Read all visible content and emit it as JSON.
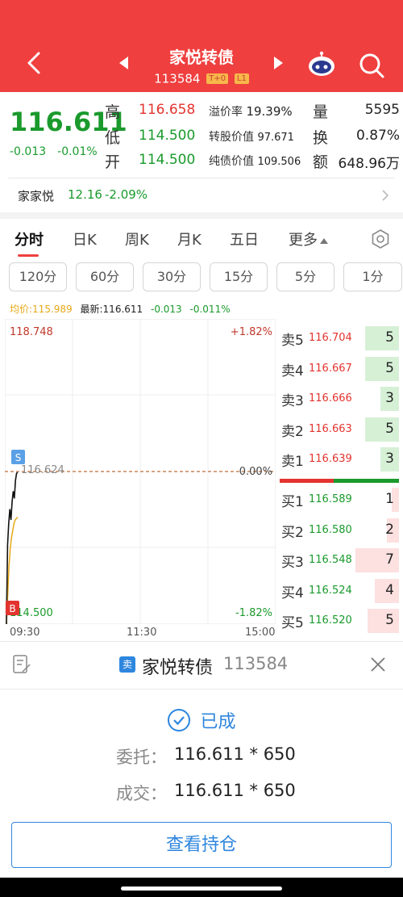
{
  "header": {
    "title": "家悦转债",
    "code": "113584",
    "tag1": "T+0",
    "tag2": "L1",
    "icons": [
      "back-icon",
      "prev-arrow-icon",
      "next-arrow-icon",
      "robot-assistant-icon",
      "search-icon"
    ]
  },
  "quote": {
    "price": "116.611",
    "change": "-0.013",
    "change_pct": "-0.01%",
    "high_label": "高",
    "high": "116.658",
    "low_label": "低",
    "low": "114.500",
    "open_label": "开",
    "open": "114.500",
    "premium_label": "溢价率",
    "premium": "19.39%",
    "conv_value_label": "转股价值",
    "conv_value": "97.671",
    "bond_value_label": "纯债价值",
    "bond_value": "109.506",
    "volume_label": "量",
    "volume": "5595",
    "turnover_label": "换",
    "turnover": "0.87%",
    "amount_label": "额",
    "amount": "648.96万"
  },
  "underlying": {
    "name": "家家悦",
    "price": "12.16",
    "change_pct": "-2.09%"
  },
  "tabs": {
    "items": [
      "分时",
      "日K",
      "周K",
      "月K",
      "五日",
      "更多"
    ],
    "active": "分时"
  },
  "periods": [
    "120分",
    "60分",
    "30分",
    "15分",
    "5分",
    "1分"
  ],
  "info_line": {
    "avg_label": "均价:115.989",
    "latest_label": "最新:116.611",
    "change": "-0.013",
    "change_pct": "-0.011%"
  },
  "chart_data": {
    "type": "line",
    "y_top_label": "118.748",
    "y_bottom_label": "114.500",
    "y_mid_label": "116.624",
    "pct_top": "+1.82%",
    "pct_mid": "0.00%",
    "pct_bottom": "-1.82%",
    "x_labels": [
      "09:30",
      "11:30",
      "15:00"
    ],
    "ylim": [
      114.5,
      118.748
    ],
    "prev_close": 116.624,
    "price_series": [
      114.5,
      115.6,
      115.9,
      116.1,
      115.95,
      116.2,
      116.35,
      116.25,
      116.5,
      116.6,
      116.611
    ],
    "avg_series": [
      114.5,
      114.9,
      115.3,
      115.55,
      115.7,
      115.8,
      115.9,
      115.95,
      115.97,
      115.989
    ],
    "markers": [
      "S",
      "B"
    ],
    "colors": {
      "price": "#111111",
      "avg": "#e6a817",
      "zero": "#c8865a"
    }
  },
  "order_book": {
    "asks": [
      {
        "label": "卖5",
        "price": "116.704",
        "volume": "5",
        "fill": 0.28
      },
      {
        "label": "卖4",
        "price": "116.667",
        "volume": "5",
        "fill": 0.28
      },
      {
        "label": "卖3",
        "price": "116.666",
        "volume": "3",
        "fill": 0.15
      },
      {
        "label": "卖2",
        "price": "116.663",
        "volume": "5",
        "fill": 0.28
      },
      {
        "label": "卖1",
        "price": "116.639",
        "volume": "3",
        "fill": 0.15
      }
    ],
    "bids": [
      {
        "label": "买1",
        "price": "116.589",
        "volume": "1",
        "fill": 0.06
      },
      {
        "label": "买2",
        "price": "116.580",
        "volume": "2",
        "fill": 0.1
      },
      {
        "label": "买3",
        "price": "116.548",
        "volume": "7",
        "fill": 0.36
      },
      {
        "label": "买4",
        "price": "116.524",
        "volume": "4",
        "fill": 0.2
      },
      {
        "label": "买5",
        "price": "116.520",
        "volume": "5",
        "fill": 0.26
      }
    ],
    "buy_ratio": 0.45,
    "colors": {
      "ask": "#d6f0d6",
      "bid": "#fde0e0",
      "ask_text": "#e3342f",
      "bid_text": "#1a9a2c"
    }
  },
  "order_panel": {
    "side_badge": "卖",
    "name": "家悦转债",
    "code": "113584",
    "status": "已成",
    "commission_label": "委托：",
    "commission_value": "116.611 * 650",
    "deal_label": "成交：",
    "deal_value": "116.611 * 650",
    "view_button": "查看持仓"
  }
}
